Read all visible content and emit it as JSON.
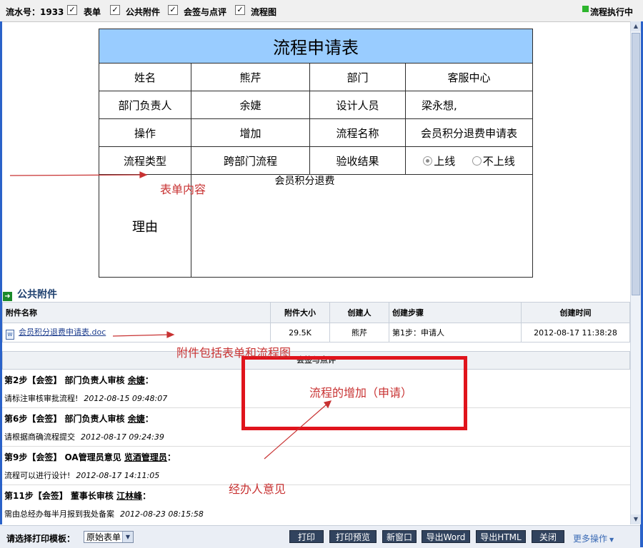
{
  "topbar": {
    "serial_label": "流水号：1933",
    "checkbox_mark": "✓",
    "form_label": "表单",
    "attachments_label": "公共附件",
    "countersign_label": "会签与点评",
    "flowchart_label": "流程图",
    "status": "流程执行中",
    "status_color": "#2db52d"
  },
  "form": {
    "title": "流程申请表",
    "title_bg": "#99ccff",
    "name_label": "姓名",
    "name_value": "熊芹",
    "dept_label": "部门",
    "dept_value": "客服中心",
    "dept_head_label": "部门负责人",
    "dept_head_value": "余婕",
    "designer_label": "设计人员",
    "designer_value": "梁永想,",
    "operation_label": "操作",
    "operation_value": "增加",
    "flow_name_label": "流程名称",
    "flow_name_value": "会员积分退费申请表",
    "flow_type_label": "流程类型",
    "flow_type_value": "跨部门流程",
    "acceptance_label": "验收结果",
    "option_online": "上线",
    "option_offline": "不上线",
    "selected_option": "上线",
    "reason_label": "理由",
    "reason_value": "会员积分退费"
  },
  "annotations": {
    "form_content": "表单内容",
    "attachments_note": "附件包括表单和流程图",
    "flow_add": "流程的增加（申请）",
    "handler_opinion": "经办人意见",
    "color": "#c83232"
  },
  "attachments": {
    "heading": "公共附件",
    "columns": [
      "附件名称",
      "附件大小",
      "创建人",
      "创建步骤",
      "创建时间"
    ],
    "rows": [
      {
        "name": "会员积分退费申请表.doc",
        "size": "29.5K",
        "creator": "熊芹",
        "step": "第1步：申请人",
        "time": "2012-08-17 11:38:28"
      }
    ]
  },
  "comments": {
    "header": "会签与点评",
    "items": [
      {
        "title": "第2步【会签】 部门负责人审核",
        "who": "余婕",
        "body": "请标注审核审批流程!",
        "date": "2012-08-15 09:48:07"
      },
      {
        "title": "第6步【会签】 部门负责人审核",
        "who": "余婕",
        "body": "请根据商确流程提交",
        "date": "2012-08-17 09:24:39"
      },
      {
        "title": "第9步【会签】 OA管理员意见",
        "who": "览酒管理员",
        "body": "流程可以进行设计!",
        "date": "2012-08-17 14:11:05"
      },
      {
        "title": "第11步【会签】 董事长审核",
        "who": "江林峰",
        "body": "需由总经办每半月报到我处备案",
        "date": "2012-08-23 08:15:58"
      }
    ]
  },
  "bottombar": {
    "print_template_label": "请选择打印模板：",
    "template_value": "原始表单",
    "buttons": [
      "打印",
      "打印预览",
      "新窗口",
      "导出Word",
      "导出HTML",
      "关闭"
    ],
    "more_ops": "更多操作"
  }
}
